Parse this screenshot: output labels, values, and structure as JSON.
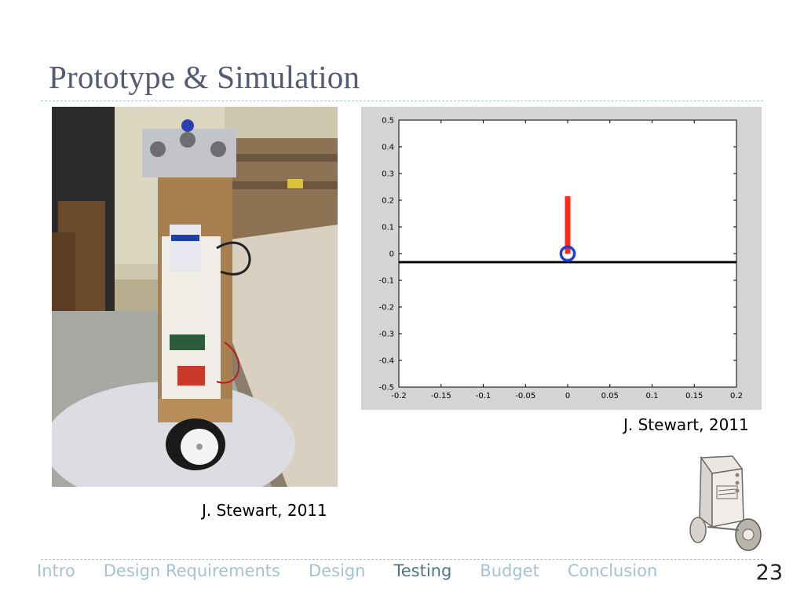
{
  "slide": {
    "title": "Prototype & Simulation",
    "page_number": "23"
  },
  "captions": {
    "plot": "J. Stewart, 2011",
    "photo": "J. Stewart, 2011"
  },
  "nav": {
    "items": [
      {
        "label": "Intro",
        "active": false
      },
      {
        "label": "Design Requirements",
        "active": false
      },
      {
        "label": "Design",
        "active": false
      },
      {
        "label": "Testing",
        "active": true
      },
      {
        "label": "Budget",
        "active": false
      },
      {
        "label": "Conclusion",
        "active": false
      }
    ]
  },
  "colors": {
    "title": "#565b74",
    "nav_inactive": "#a3c2d6",
    "nav_active": "#4e7488",
    "plot_frame": "#d4d4d4",
    "pendulum": "#ff2a1a",
    "wheel": "#1f3fd6"
  },
  "chart_data": {
    "type": "line",
    "title": "",
    "xlabel": "",
    "ylabel": "",
    "xlim": [
      -0.2,
      0.2
    ],
    "ylim": [
      -0.5,
      0.5
    ],
    "xticks": [
      "-0.2",
      "-0.15",
      "-0.1",
      "-0.05",
      "0",
      "0.05",
      "0.1",
      "0.15",
      "0.2"
    ],
    "xtick_values": [
      -0.2,
      -0.15,
      -0.1,
      -0.05,
      0,
      0.05,
      0.1,
      0.15,
      0.2
    ],
    "yticks": [
      "0.5",
      "0.4",
      "0.3",
      "0.2",
      "0.1",
      "0",
      "-0.1",
      "-0.2",
      "-0.3",
      "-0.4",
      "-0.5"
    ],
    "ytick_values": [
      0.5,
      0.4,
      0.3,
      0.2,
      0.1,
      0,
      -0.1,
      -0.2,
      -0.3,
      -0.4,
      -0.5
    ],
    "grid": false,
    "ground_line": {
      "y": -0.032
    },
    "pendulum": {
      "x": 0,
      "y_bottom": 0,
      "y_top": 0.215
    },
    "wheel": {
      "x": 0,
      "y": 0,
      "radius": 0.008
    }
  }
}
